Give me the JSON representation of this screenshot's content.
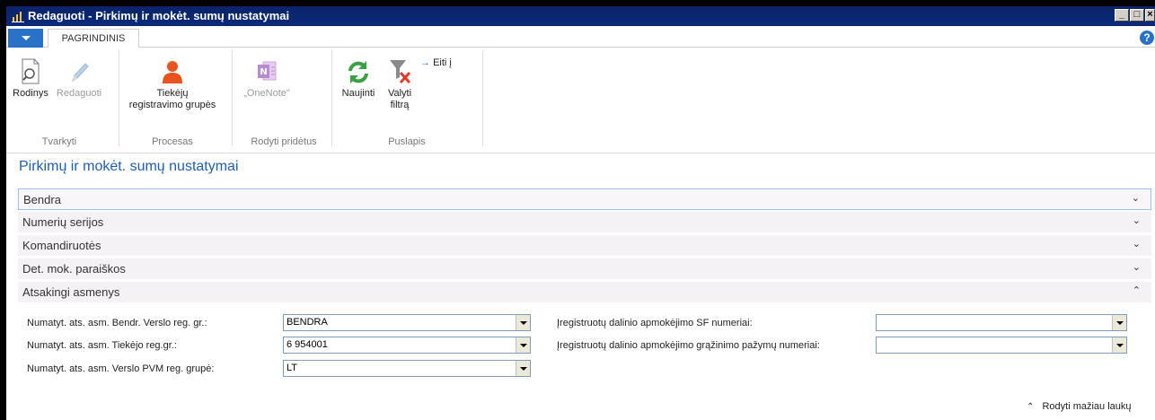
{
  "window": {
    "title": "Redaguoti - Pirkimų ir mokėt. sumų nustatymai",
    "controls": [
      "_",
      "□",
      "×"
    ]
  },
  "ribbon": {
    "tab_home": "PAGRINDINIS",
    "help_icon": "?",
    "buttons": {
      "view": "Rodinys",
      "edit": "Redaguoti",
      "vendor_line1": "Tiekėjų",
      "vendor_line2": "registravimo grupės",
      "onenote": "„OneNote\"",
      "refresh": "Naujinti",
      "clear_line1": "Valyti",
      "clear_line2": "filtrą",
      "goto": "Eiti į"
    },
    "groups": {
      "manage": "Tvarkyti",
      "process": "Procesas",
      "show_attached": "Rodyti pridėtus",
      "page": "Puslapis"
    },
    "icons": {
      "view": "page-magnifier-icon",
      "edit": "pencil-icon",
      "vendor": "person-icon",
      "onenote": "onenote-icon",
      "refresh": "refresh-icon",
      "clear_filter": "filter-clear-icon",
      "goto": "arrow-right-icon"
    }
  },
  "page": {
    "title": "Pirkimų ir mokėt. sumų nustatymai",
    "fasttabs": [
      {
        "label": "Bendra",
        "chevron": "⌄"
      },
      {
        "label": "Numerių serijos",
        "chevron": "⌄"
      },
      {
        "label": "Komandiruotės",
        "chevron": "⌄"
      },
      {
        "label": "Det. mok. paraiškos",
        "chevron": "⌄"
      },
      {
        "label": "Atsakingi asmenys",
        "chevron": "⌃"
      }
    ],
    "fields_left": [
      {
        "label": "Numatyt. ats. asm. Bendr. Verslo reg. gr.:",
        "value": "BENDRA"
      },
      {
        "label": "Numatyt. ats. asm. Tiekėjo reg.gr.:",
        "value": "6 954001"
      },
      {
        "label": "Numatyt. ats. asm. Verslo PVM reg. grupė:",
        "value": "LT"
      }
    ],
    "fields_right": [
      {
        "label": "Įregistruotų dalinio apmokėjimo SF numeriai:",
        "value": ""
      },
      {
        "label": "Įregistruotų dalinio apmokėjimo grąžinimo pažymų numeriai:",
        "value": ""
      }
    ],
    "show_less": "Rodyti mažiau laukų",
    "show_less_chevron": "⌃"
  },
  "colors": {
    "accent": "#2a72c8",
    "title_blue": "#1f5fb0",
    "titlebar": "#0a246a"
  }
}
